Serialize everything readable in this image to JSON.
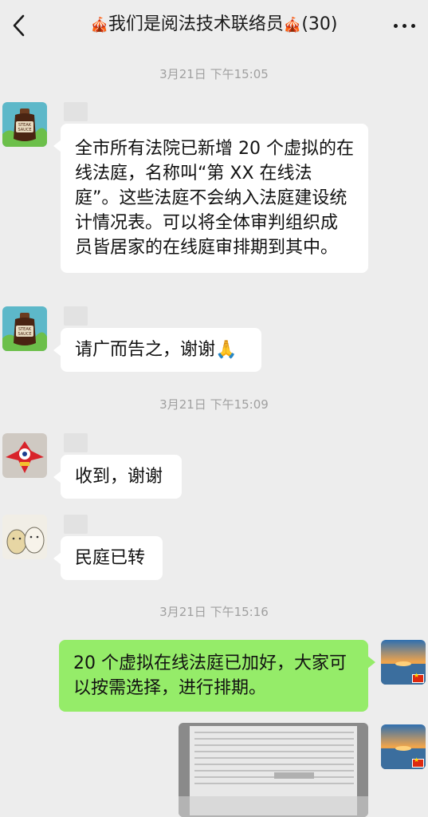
{
  "header": {
    "title": "我们是阅法技术联络员",
    "member_count": "(30)",
    "back_icon": "chevron-left-icon",
    "more_icon": "more-dots-icon"
  },
  "messages": [
    {
      "type": "timestamp",
      "text": "3月21日 下午15:05"
    },
    {
      "type": "text",
      "side": "left",
      "text": "全市所有法院已新增 20 个虚拟的在线法庭，名称叫“第 XX 在线法庭”。这些法庭不会纳入法庭建设统计情况表。可以将全体审判组织成员皆居家的在线庭审排期到其中。"
    },
    {
      "type": "text",
      "side": "left",
      "text": "请广而告之，谢谢🙏"
    },
    {
      "type": "timestamp",
      "text": "3月21日 下午15:09"
    },
    {
      "type": "text",
      "side": "left",
      "text": "收到，谢谢"
    },
    {
      "type": "text",
      "side": "left",
      "text": "民庭已转"
    },
    {
      "type": "timestamp",
      "text": "3月21日 下午15:16"
    },
    {
      "type": "text",
      "side": "right",
      "text": "20 个虚拟在线法庭已加好，大家可以按需选择，进行排期。"
    },
    {
      "type": "image",
      "side": "right"
    }
  ],
  "colors": {
    "background": "#ededed",
    "bubble_self": "#95ec69",
    "bubble_other": "#ffffff"
  }
}
